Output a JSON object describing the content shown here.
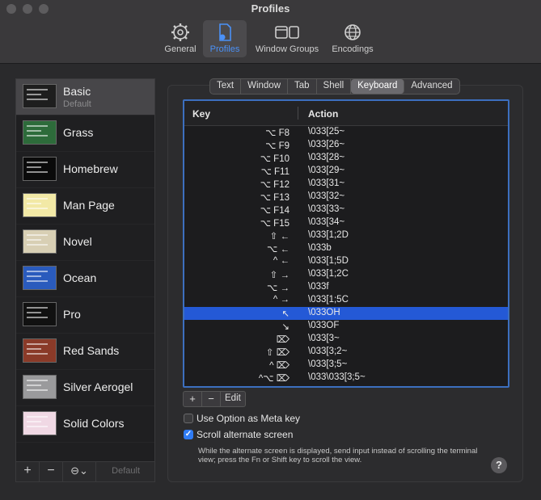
{
  "window": {
    "title": "Profiles"
  },
  "toolbar": [
    {
      "label": "General",
      "icon": "gear-icon",
      "active": false
    },
    {
      "label": "Profiles",
      "icon": "profile-doc-icon",
      "active": true
    },
    {
      "label": "Window Groups",
      "icon": "window-groups-icon",
      "active": false
    },
    {
      "label": "Encodings",
      "icon": "globe-icon",
      "active": false
    }
  ],
  "profiles": [
    {
      "name": "Basic",
      "sub": "Default",
      "bg": "#1e1e1e",
      "selected": true
    },
    {
      "name": "Grass",
      "bg": "#2d6b3a"
    },
    {
      "name": "Homebrew",
      "bg": "#0a0a0a"
    },
    {
      "name": "Man Page",
      "bg": "#f2e9a6"
    },
    {
      "name": "Novel",
      "bg": "#d8cfb4"
    },
    {
      "name": "Ocean",
      "bg": "#2a5bbd"
    },
    {
      "name": "Pro",
      "bg": "#111111"
    },
    {
      "name": "Red Sands",
      "bg": "#8a3a28"
    },
    {
      "name": "Silver Aerogel",
      "bg": "#9a9a9c"
    },
    {
      "name": "Solid Colors",
      "bg": "#f0d8e4"
    }
  ],
  "sidebar_bottom": {
    "add": "+",
    "remove": "−",
    "more": "⊖⌄",
    "default_label": "Default"
  },
  "tabs": [
    "Text",
    "Window",
    "Tab",
    "Shell",
    "Keyboard",
    "Advanced"
  ],
  "active_tab": "Keyboard",
  "table": {
    "col_key": "Key",
    "col_action": "Action",
    "rows": [
      {
        "key": "⌥ F8",
        "action": "\\033[25~"
      },
      {
        "key": "⌥ F9",
        "action": "\\033[26~"
      },
      {
        "key": "⌥ F10",
        "action": "\\033[28~"
      },
      {
        "key": "⌥ F11",
        "action": "\\033[29~"
      },
      {
        "key": "⌥ F12",
        "action": "\\033[31~"
      },
      {
        "key": "⌥ F13",
        "action": "\\033[32~"
      },
      {
        "key": "⌥ F14",
        "action": "\\033[33~"
      },
      {
        "key": "⌥ F15",
        "action": "\\033[34~"
      },
      {
        "key": "⇧ ←",
        "action": "\\033[1;2D"
      },
      {
        "key": "⌥ ←",
        "action": "\\033b"
      },
      {
        "key": "^ ←",
        "action": "\\033[1;5D"
      },
      {
        "key": "⇧ →",
        "action": "\\033[1;2C"
      },
      {
        "key": "⌥ →",
        "action": "\\033f"
      },
      {
        "key": "^ →",
        "action": "\\033[1;5C"
      },
      {
        "key": "↖",
        "action": "\\033OH",
        "selected": true
      },
      {
        "key": "↘",
        "action": "\\033OF"
      },
      {
        "key": "⌦",
        "action": "\\033[3~"
      },
      {
        "key": "⇧ ⌦",
        "action": "\\033[3;2~"
      },
      {
        "key": "^ ⌦",
        "action": "\\033[3;5~"
      },
      {
        "key": "^⌥ ⌦",
        "action": "\\033\\033[3;5~"
      }
    ]
  },
  "buttons": {
    "add": "+",
    "remove": "−",
    "edit": "Edit"
  },
  "options": {
    "meta_key": {
      "label": "Use Option as Meta key",
      "checked": false
    },
    "scroll_alt": {
      "label": "Scroll alternate screen",
      "checked": true
    },
    "help_text": "While the alternate screen is displayed, send input instead of scrolling the terminal view; press the Fn or Shift key to scroll the view."
  },
  "help_button": "?"
}
